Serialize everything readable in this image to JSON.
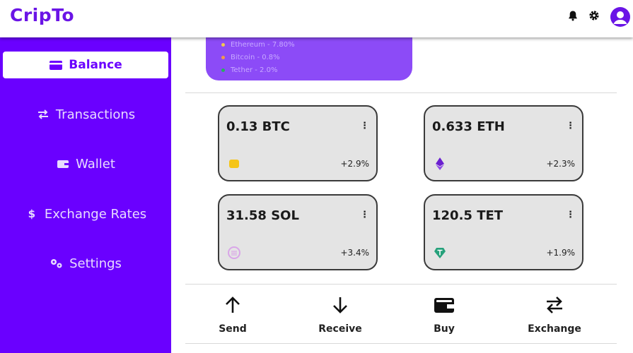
{
  "app": {
    "title": "CripTo"
  },
  "header": {
    "icons": [
      "bell-icon",
      "gear-icon",
      "user-avatar-icon"
    ]
  },
  "colors": {
    "brand": "#6a00ff",
    "promo": "#8c4bf7",
    "card_bg": "#e4e4e4"
  },
  "sidebar": {
    "items": [
      {
        "label": "Balance",
        "icon": "credit-card-icon",
        "active": true
      },
      {
        "label": "Transactions",
        "icon": "arrows-swap-icon",
        "active": false
      },
      {
        "label": "Wallet",
        "icon": "wallet-icon",
        "active": false
      },
      {
        "label": "Exchange Rates",
        "icon": "dollar-icon",
        "active": false
      },
      {
        "label": "Settings",
        "icon": "gears-icon",
        "active": false
      }
    ]
  },
  "promo": {
    "lines": [
      {
        "text": "Ethereum - 7.80%",
        "color": "#f2c94c"
      },
      {
        "text": "Bitcoin - 0.8%",
        "color": "#f2994a"
      },
      {
        "text": "Tether - 2.0%",
        "color": "#27ae60"
      }
    ]
  },
  "cards": [
    {
      "amount": "0.13 BTC",
      "change": "+2.9%",
      "coin_icon": "bitcoin-coin-icon",
      "coin_color": "#f5c518"
    },
    {
      "amount": "0.633 ETH",
      "change": "+2.3%",
      "coin_icon": "ethereum-icon",
      "coin_color": "#6a1fd0"
    },
    {
      "amount": "31.58 SOL",
      "change": "+3.4%",
      "coin_icon": "solana-coin-icon",
      "coin_color": "#d9a6e8"
    },
    {
      "amount": "120.5 TET",
      "change": "+1.9%",
      "coin_icon": "tether-icon",
      "coin_color": "#26a17b"
    }
  ],
  "actions": [
    {
      "label": "Send",
      "icon": "arrow-up-icon"
    },
    {
      "label": "Receive",
      "icon": "arrow-down-icon"
    },
    {
      "label": "Buy",
      "icon": "wallet-icon"
    },
    {
      "label": "Exchange",
      "icon": "arrows-swap-icon"
    }
  ]
}
